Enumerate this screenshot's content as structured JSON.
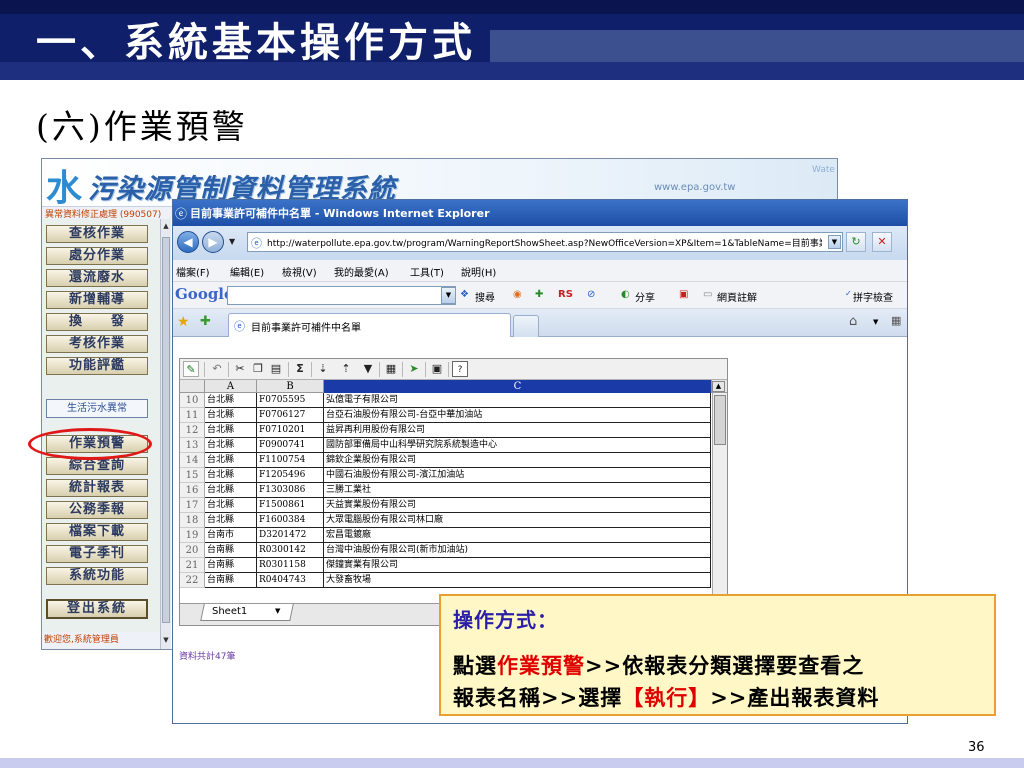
{
  "slide": {
    "title": "一、系統基本操作方式",
    "subtitle": "(六)作業預警",
    "page_number": "36"
  },
  "portal": {
    "logo_water": "水",
    "logo_text": "污染源管制資料管理系統",
    "url_text": "www.epa.gov.tw",
    "water_text": "Wate",
    "menu_title": "異常資料修正處理 (990507)",
    "sidebar_items": [
      "查核作業",
      "處分作業",
      "還流廢水",
      "新增輔導",
      "換　　發",
      "考核作業",
      "功能評鑑"
    ],
    "sidebar_section": "生活污水異常",
    "sidebar_items2": [
      "作業預警",
      "綜合查詢",
      "統計報表",
      "公務季報",
      "檔案下載",
      "電子季刊",
      "系統功能"
    ],
    "login_label": "登出系統",
    "welcome_text": "歡迎您,系統管理員"
  },
  "ie": {
    "title": "目前事業許可補件中名單 - Windows Internet Explorer",
    "address": "http://waterpollute.epa.gov.tw/program/WarningReportShowSheet.asp?NewOfficeVersion=XP&Item=1&TableName=目前事業",
    "menu": [
      "檔案(F)",
      "編輯(E)",
      "檢視(V)",
      "我的最愛(A)",
      "工具(T)",
      "說明(H)"
    ],
    "google_logo": "Google",
    "google_toolbar": [
      "搜尋",
      "分享",
      "網頁註解",
      "拼字檢查"
    ],
    "tab_label": "目前事業許可補件中名單"
  },
  "sheet": {
    "columns": [
      "A",
      "B",
      "C"
    ],
    "rows": [
      {
        "n": "10",
        "a": "台北縣",
        "b": "F0705595",
        "c": "弘億電子有限公司"
      },
      {
        "n": "11",
        "a": "台北縣",
        "b": "F0706127",
        "c": "台亞石油股份有限公司-台亞中華加油站"
      },
      {
        "n": "12",
        "a": "台北縣",
        "b": "F0710201",
        "c": "益昇再利用股份有限公司"
      },
      {
        "n": "13",
        "a": "台北縣",
        "b": "F0900741",
        "c": "國防部軍備局中山科學研究院系統製造中心"
      },
      {
        "n": "14",
        "a": "台北縣",
        "b": "F1100754",
        "c": "錦欽企業股份有限公司"
      },
      {
        "n": "15",
        "a": "台北縣",
        "b": "F1205496",
        "c": "中國石油股份有限公司-濱江加油站"
      },
      {
        "n": "16",
        "a": "台北縣",
        "b": "F1303086",
        "c": "三勝工業社"
      },
      {
        "n": "17",
        "a": "台北縣",
        "b": "F1500861",
        "c": "天益實業股份有限公司"
      },
      {
        "n": "18",
        "a": "台北縣",
        "b": "F1600384",
        "c": "大眾電腦股份有限公司林口廠"
      },
      {
        "n": "19",
        "a": "台南市",
        "b": "D3201472",
        "c": "宏昌電鍍廠"
      },
      {
        "n": "20",
        "a": "台南縣",
        "b": "R0300142",
        "c": "台灣中油股份有限公司(新市加油站)"
      },
      {
        "n": "21",
        "a": "台南縣",
        "b": "R0301158",
        "c": "傑鐘實業有限公司"
      },
      {
        "n": "22",
        "a": "台南縣",
        "b": "R0404743",
        "c": "大發畜牧場"
      }
    ],
    "sheet_tab": "Sheet1",
    "total": "資料共計47筆"
  },
  "callout": {
    "heading": "操作方式：",
    "line1_pre": "點選",
    "line1_red": "作業預警",
    "line1_post": ">>依報表分類選擇要查看之",
    "line2_pre": "報表名稱>>選擇",
    "line2_red": "【執行】",
    "line2_post": ">>產出報表資料"
  }
}
